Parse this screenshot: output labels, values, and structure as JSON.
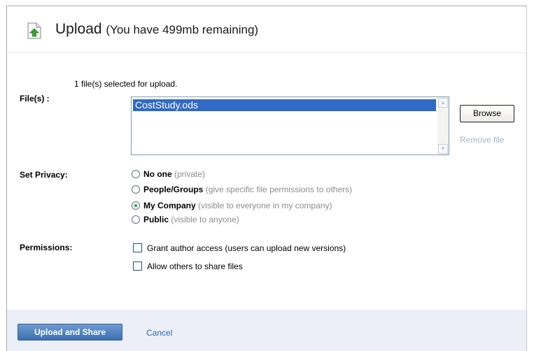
{
  "header": {
    "title": "Upload",
    "subtitle": "(You have 499mb remaining)",
    "icon": "upload-icon"
  },
  "files": {
    "selected_count_text": "1 file(s) selected for upload.",
    "label": "File(s) :",
    "items": [
      "CostStudy.ods"
    ],
    "browse_label": "Browse",
    "remove_label": "Remove file"
  },
  "privacy": {
    "label": "Set Privacy:",
    "options": [
      {
        "label": "No one",
        "hint": "(private)",
        "selected": false
      },
      {
        "label": "People/Groups",
        "hint": "(give specific file permissions to others)",
        "selected": false
      },
      {
        "label": "My Company",
        "hint": "(visible to everyone in my company)",
        "selected": true
      },
      {
        "label": "Public",
        "hint": "(visible to anyone)",
        "selected": false
      }
    ]
  },
  "permissions": {
    "label": "Permissions:",
    "options": [
      {
        "label": "Grant author access (users can upload new versions)",
        "checked": false
      },
      {
        "label": "Allow others to share files",
        "checked": false
      }
    ]
  },
  "footer": {
    "primary_label": "Upload and Share",
    "cancel_label": "Cancel"
  },
  "colors": {
    "selection": "#316ac5",
    "primary_button": "#3c70b0",
    "link": "#2a6ab0",
    "radio_selected": "#21a121"
  }
}
